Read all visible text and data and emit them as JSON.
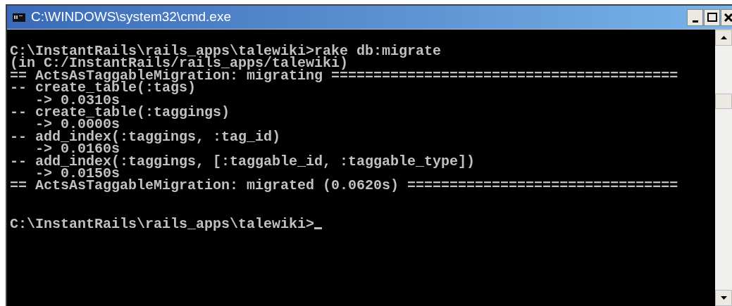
{
  "window": {
    "title": "C:\\WINDOWS\\system32\\cmd.exe"
  },
  "console": {
    "lines": [
      "C:\\InstantRails\\rails_apps\\talewiki>rake db:migrate",
      "(in C:/InstantRails/rails_apps/talewiki)",
      "== ActsAsTaggableMigration: migrating =========================================",
      "-- create_table(:tags)",
      "   -> 0.0310s",
      "-- create_table(:taggings)",
      "   -> 0.0000s",
      "-- add_index(:taggings, :tag_id)",
      "   -> 0.0160s",
      "-- add_index(:taggings, [:taggable_id, :taggable_type])",
      "   -> 0.0150s",
      "== ActsAsTaggableMigration: migrated (0.0620s) ================================"
    ],
    "prompt": "C:\\InstantRails\\rails_apps\\talewiki>"
  }
}
